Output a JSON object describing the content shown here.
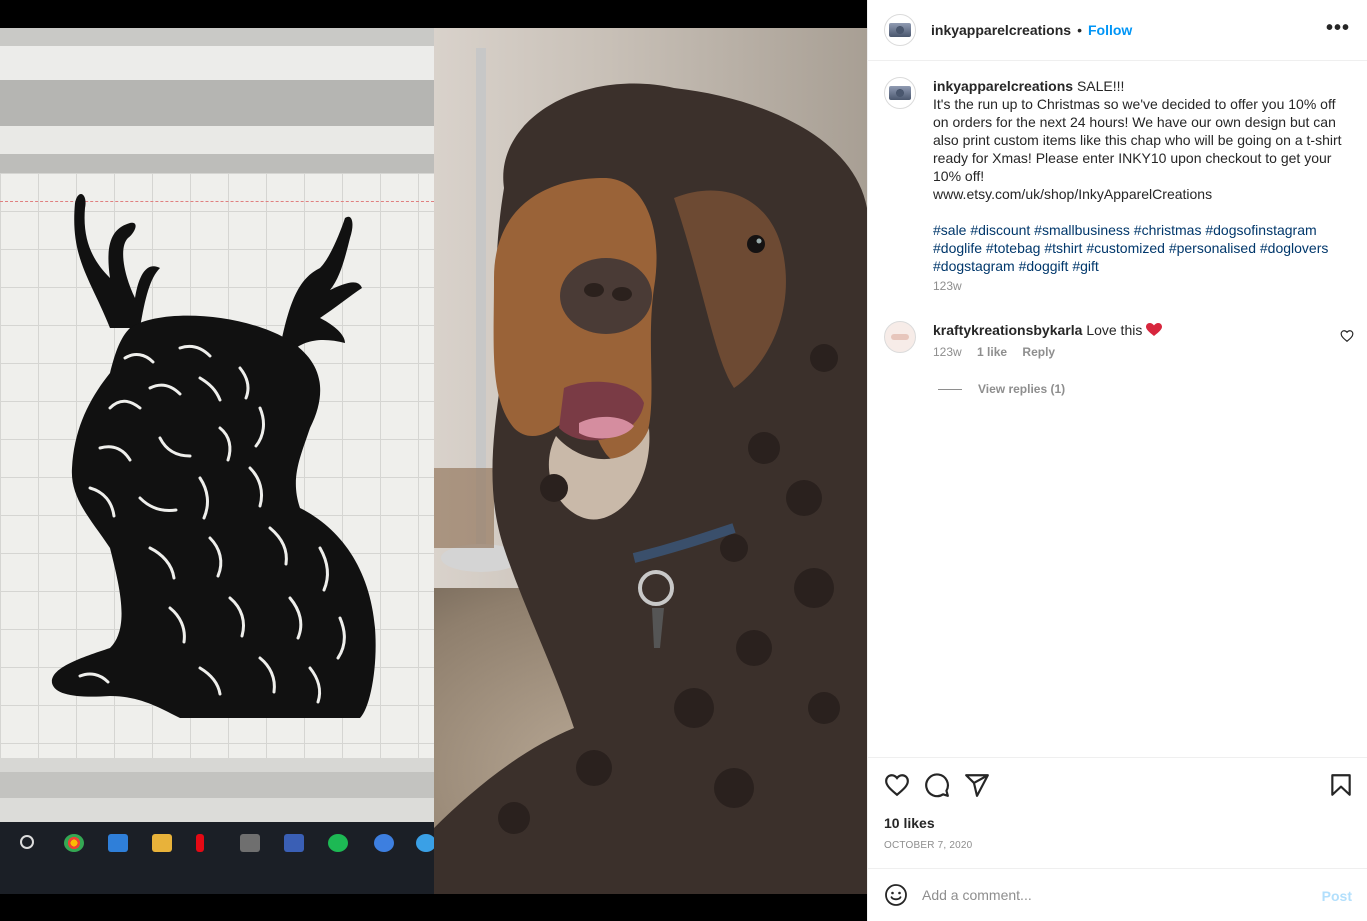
{
  "post": {
    "username": "inkyapparelcreations",
    "follow_label": "Follow",
    "separator": "•",
    "more_label": "•••",
    "caption": {
      "username": "inkyapparelcreations",
      "lines": [
        "SALE!!!",
        "It's the run up to Christmas so we've decided to offer you 10% off on orders for the next 24 hours! We have our own design but can also print custom items like this chap who will be going on a t-shirt ready for Xmas! Please enter INKY10 upon checkout to get your 10% off!",
        "www.etsy.com/uk/shop/InkyApparelCreations"
      ],
      "hashtags": "#sale #discount #smallbusiness #christmas #dogsofinstagram #doglife #totebag #tshirt #customized #personalised #doglovers #dogstagram #doggift #gift",
      "time": "123w"
    },
    "comment": {
      "username": "kraftykreationsbykarla",
      "text": "Love this",
      "time": "123w",
      "likes": "1 like",
      "reply_label": "Reply",
      "view_replies": "View replies (1)"
    },
    "likes_label": "10 likes",
    "date": "OCTOBER 7, 2020",
    "add_comment_placeholder": "Add a comment...",
    "post_button": "Post"
  },
  "icons": {
    "like": "heart-icon",
    "comment": "comment-icon",
    "share": "share-icon",
    "save": "bookmark-icon",
    "emoji": "emoji-icon"
  },
  "colors": {
    "link_blue": "#0095f6",
    "hashtag_blue": "#00376b",
    "muted_text": "#8e8e8e",
    "post_disabled": "#b2dffc",
    "heart_red": "#ed4956"
  }
}
